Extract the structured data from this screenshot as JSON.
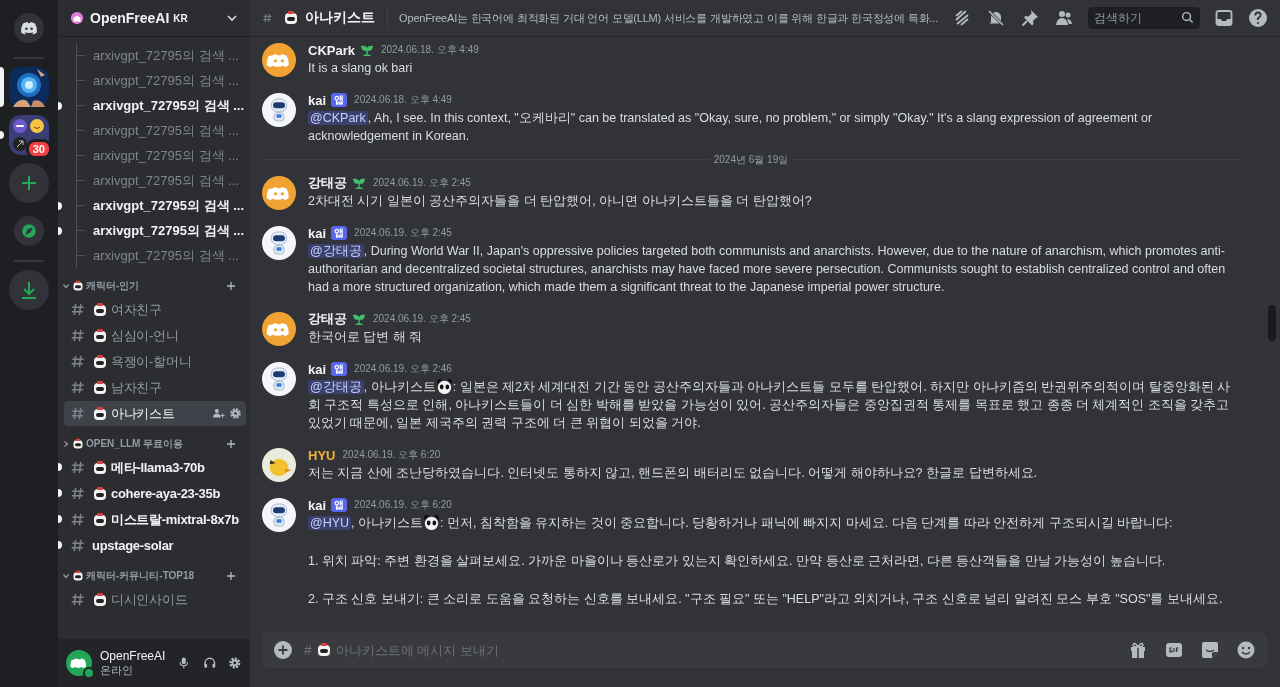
{
  "servers": [
    {
      "kind": "home",
      "selected": false,
      "unread": false
    },
    {
      "kind": "picture",
      "selected": true,
      "unread": false
    },
    {
      "kind": "folder",
      "selected": false,
      "unread": true,
      "badge": "30"
    },
    {
      "kind": "add",
      "selected": false,
      "unread": false
    },
    {
      "kind": "discover",
      "selected": false,
      "unread": false
    },
    {
      "kind": "download",
      "selected": false,
      "unread": false
    }
  ],
  "server": {
    "name": "OpenFreeAI",
    "tag": "KR"
  },
  "threads": [
    {
      "label": "arxivgpt_72795의 검색 ...",
      "unread": false
    },
    {
      "label": "arxivgpt_72795의 검색 ...",
      "unread": false
    },
    {
      "label": "arxivgpt_72795의 검색 ...",
      "unread": true
    },
    {
      "label": "arxivgpt_72795의 검색 ...",
      "unread": false
    },
    {
      "label": "arxivgpt_72795의 검색 ...",
      "unread": false
    },
    {
      "label": "arxivgpt_72795의 검색 ...",
      "unread": false
    },
    {
      "label": "arxivgpt_72795의 검색 ...",
      "unread": true
    },
    {
      "label": "arxivgpt_72795의 검색 ...",
      "unread": true
    },
    {
      "label": "arxivgpt_72795의 검색 ...",
      "unread": false
    }
  ],
  "categories": [
    {
      "name": "캐릭터-인기",
      "expanded": true,
      "channels": [
        {
          "name": "여자친구",
          "emoji": true,
          "unread": false,
          "selected": false
        },
        {
          "name": "심심이-언니",
          "emoji": true,
          "unread": false,
          "selected": false
        },
        {
          "name": "욕쟁이-할머니",
          "emoji": true,
          "unread": false,
          "selected": false
        },
        {
          "name": "남자친구",
          "emoji": true,
          "unread": false,
          "selected": false
        },
        {
          "name": "아나키스트",
          "emoji": true,
          "unread": false,
          "selected": true
        }
      ]
    },
    {
      "name": "OPEN_LLM 무료이용",
      "expanded": false,
      "channels": [
        {
          "name": "메타-llama3-70b",
          "emoji": true,
          "unread": true,
          "selected": false
        },
        {
          "name": "cohere-aya-23-35b",
          "emoji": true,
          "unread": true,
          "selected": false
        },
        {
          "name": "미스트랄-mixtral-8x7b",
          "emoji": true,
          "unread": true,
          "selected": false
        },
        {
          "name": "upstage-solar",
          "emoji": false,
          "unread": true,
          "selected": false
        }
      ]
    },
    {
      "name": "캐릭터-커뮤니티-TOP18",
      "expanded": true,
      "channels": [
        {
          "name": "디시인사이드",
          "emoji": true,
          "unread": false,
          "selected": false
        }
      ]
    }
  ],
  "user": {
    "name": "OpenFreeAI",
    "status": "온라인"
  },
  "channel": {
    "name": "아나키스트",
    "topic": "OpenFreeAI는 한국어에 최적화된 거대 언어 모델(LLM) 서비스를 개발하였고 이를 위해 한글과 한국정성에 특화...",
    "search_placeholder": "검색하기"
  },
  "messages": [
    {
      "author": "CKPark",
      "color": "#f2f3f5",
      "avatar": {
        "kind": "default"
      },
      "role_icon": true,
      "timestamp": "2024.06.18. 오후 4:49",
      "content": [
        [
          {
            "kind": "text",
            "text": "It is a slang ok bari"
          }
        ]
      ]
    },
    {
      "author": "kai",
      "color": "#f2f3f5",
      "avatar": {
        "kind": "robot"
      },
      "badge": "앱",
      "timestamp": "2024.06.18. 오후 4:49",
      "content": [
        [
          {
            "kind": "mention",
            "text": "@CKPark"
          },
          {
            "kind": "text",
            "text": ", Ah, I see. In this context, \"오케바리\" can be translated as \"Okay, sure, no problem,\" or simply \"Okay.\" It's a slang expression of agreement or acknowledgement in Korean."
          }
        ]
      ]
    },
    {
      "divider": "2024년 6월 19일",
      "author": "강태공",
      "color": "#f2f3f5",
      "avatar": {
        "kind": "default"
      },
      "role_icon": true,
      "timestamp": "2024.06.19. 오후 2:45",
      "content": [
        [
          {
            "kind": "text",
            "text": "2차대전 시기 일본이 공산주의자들을 더 탄압했어, 아니면 아나키스트들을 더 탄압했어?"
          }
        ]
      ]
    },
    {
      "author": "kai",
      "color": "#f2f3f5",
      "avatar": {
        "kind": "robot"
      },
      "badge": "앱",
      "timestamp": "2024.06.19. 오후 2:45",
      "content": [
        [
          {
            "kind": "mention",
            "text": "@강태공"
          },
          {
            "kind": "text",
            "text": ", During World War II, Japan's oppressive policies targeted both communists and anarchists. However, due to the nature of anarchism, which promotes anti-authoritarian and decentralized societal structures, anarchists may have faced more severe persecution. Communists sought to establish centralized control and often had a more structured organization, which made them a significant threat to the Japanese imperial power structure."
          }
        ]
      ]
    },
    {
      "author": "강태공",
      "color": "#f2f3f5",
      "avatar": {
        "kind": "default"
      },
      "role_icon": true,
      "timestamp": "2024.06.19. 오후 2:45",
      "content": [
        [
          {
            "kind": "text",
            "text": "한국어로 답변 해 줘"
          }
        ]
      ]
    },
    {
      "author": "kai",
      "color": "#f2f3f5",
      "avatar": {
        "kind": "robot"
      },
      "badge": "앱",
      "timestamp": "2024.06.19. 오후 2:46",
      "content": [
        [
          {
            "kind": "mention",
            "text": "@강태공"
          },
          {
            "kind": "text",
            "text": ", 아나키스트"
          },
          {
            "kind": "emoji"
          },
          {
            "kind": "text",
            "text": ": 일본은 제2차 세계대전 기간 동안 공산주의자들과 아나키스트들 모두를 탄압했어. 하지만 아나키즘의 반권위주의적이며 탈중앙화된 사회 구조적 특성으로 인해, 아나키스트들이 더 심한 박해를 받았을 가능성이 있어. 공산주의자들은 중앙집권적 통제를 목표로 했고 종종 더 체계적인 조직을 갖추고 있었기 때문에, 일본 제국주의 권력 구조에 더 큰 위협이 되었을 거야."
          }
        ]
      ]
    },
    {
      "author": "HYU",
      "color": "#f0b232",
      "avatar": {
        "kind": "chick"
      },
      "timestamp": "2024.06.19. 오후 6:20",
      "content": [
        [
          {
            "kind": "text",
            "text": "저는 지금 산에 조난당하였습니다. 인터넷도 통하지 않고, 핸드폰의 배터리도 없습니다. 어떻게 해야하나요? 한글로 답변하세요."
          }
        ]
      ]
    },
    {
      "author": "kai",
      "color": "#f2f3f5",
      "avatar": {
        "kind": "robot"
      },
      "badge": "앱",
      "timestamp": "2024.06.19. 오후 6:20",
      "content": [
        [
          {
            "kind": "mention",
            "text": "@HYU"
          },
          {
            "kind": "text",
            "text": ", 아나키스트"
          },
          {
            "kind": "emoji"
          },
          {
            "kind": "text",
            "text": ": 먼저, 침착함을 유지하는 것이 중요합니다. 당황하거나 패닉에 빠지지 마세요. 다음 단계를 따라 안전하게 구조되시길 바랍니다:"
          }
        ],
        [
          {
            "kind": "text",
            "text": "1. 위치 파악: 주변 환경을 살펴보세요. 가까운 마을이나 등산로가 있는지 확인하세요. 만약 등산로 근처라면, 다른 등산객들을 만날 가능성이 높습니다."
          }
        ],
        [
          {
            "kind": "text",
            "text": "2. 구조 신호 보내기: 큰 소리로 도움을 요청하는 신호를 보내세요. \"구조 필요\" 또는 \"HELP\"라고 외치거나, 구조 신호로 널리 알려진 모스 부호 \"SOS\"를 보내세요."
          }
        ]
      ]
    }
  ],
  "composer": {
    "prefix": "#",
    "placeholder": "아나키스트에 메시지 보내기"
  }
}
